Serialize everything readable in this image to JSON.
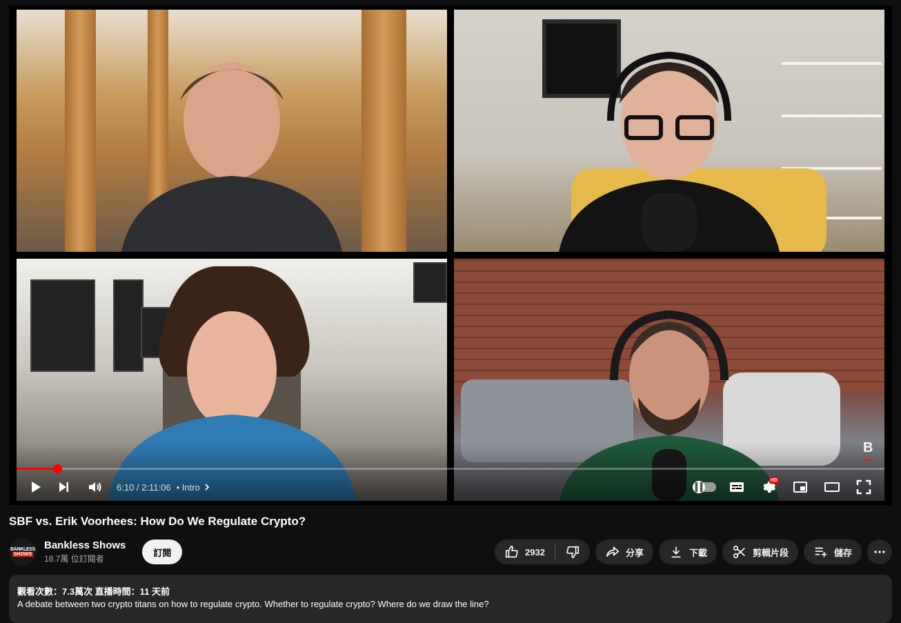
{
  "player": {
    "current_time": "6:10",
    "separator": " / ",
    "duration": "2:11:06",
    "chapter": "• Intro",
    "progress_fraction": 0.047,
    "hd_label": "HD",
    "brand_letter": "B"
  },
  "video": {
    "title": "SBF vs. Erik Voorhees: How Do We Regulate Crypto?"
  },
  "channel": {
    "name": "Bankless Shows",
    "subscribers": "18.7萬 位訂閱者",
    "avatar_line1": "BANKLESS",
    "avatar_line2": "SHOWS",
    "subscribe_label": "訂閱"
  },
  "actions": {
    "likes": "2932",
    "share": "分享",
    "download": "下載",
    "clip": "剪輯片段",
    "save": "儲存"
  },
  "description": {
    "meta": "觀看次數：7.3萬次  直播時間：11 天前",
    "text": "A debate between two crypto titans on how to regulate crypto. Whether to regulate crypto? Where do we draw the line?"
  },
  "colors": {
    "accent": "#ff0000",
    "background": "#0f0f0f",
    "pill": "#272727"
  }
}
